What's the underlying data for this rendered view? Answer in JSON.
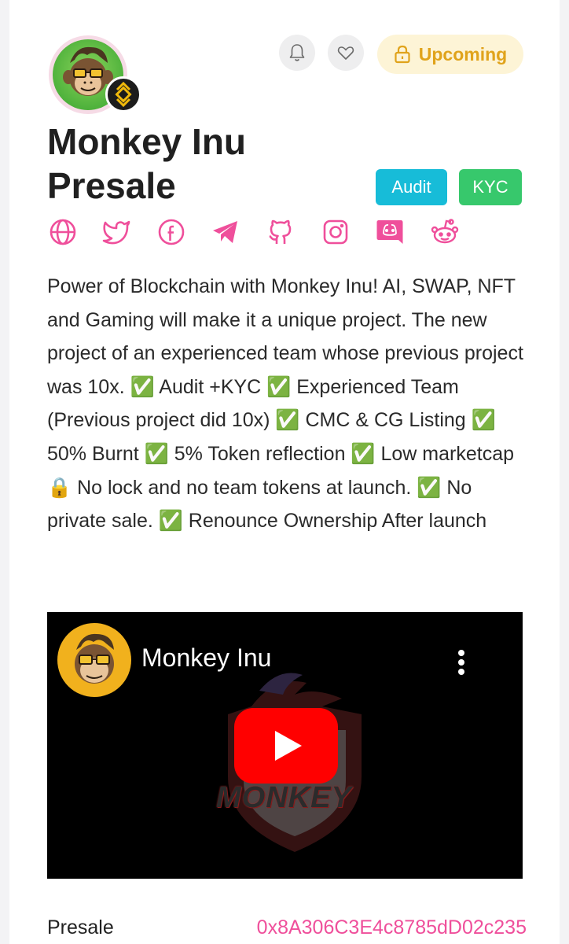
{
  "project": {
    "title": "Monkey Inu Presale",
    "status": "Upcoming",
    "status_icon": "lock-icon",
    "tags": [
      "Audit",
      "KYC"
    ],
    "description": "Power of Blockchain with Monkey Inu! AI, SWAP, NFT and Gaming will make it a unique project. The new project of an experienced team whose previous project was 10x. ✅ Audit +KYC ✅ Experienced Team (Previous project did 10x) ✅ CMC & CG Listing ✅ 50% Burnt ✅ 5% Token reflection ✅ Low marketcap 🔒 No lock and no team tokens at launch. ✅ No private sale. ✅ Renounce Ownership After launch"
  },
  "actions": {
    "notify_icon": "bell-icon",
    "favorite_icon": "heart-icon"
  },
  "socials": [
    "globe-icon",
    "twitter-icon",
    "facebook-icon",
    "telegram-icon",
    "github-icon",
    "instagram-icon",
    "discord-icon",
    "reddit-icon"
  ],
  "video": {
    "channel_name": "Monkey Inu",
    "brand_text": "MONKEY"
  },
  "presale": {
    "label": "Presale",
    "address": "0x8A306C3E4c8785dD02c235"
  },
  "colors": {
    "accent_pink": "#ef4f9b",
    "status_yellow": "#e0a31b",
    "audit_cyan": "#17bcd8",
    "kyc_green": "#37c86c",
    "youtube_red": "#ff0000"
  }
}
